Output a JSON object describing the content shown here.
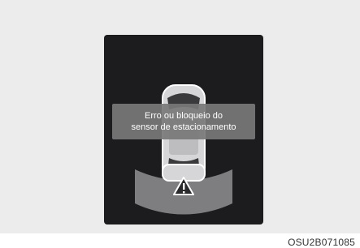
{
  "message": {
    "line1": "Erro ou bloqueio do",
    "line2": "sensor de estacionamento"
  },
  "figure_code": "OSU2B071085",
  "icons": {
    "warning": "warning-triangle-icon",
    "vehicle": "car-top-view-icon",
    "sensor_zone": "parking-sensor-arc"
  },
  "colors": {
    "page_background": "#ececec",
    "display_background": "#1c1c1e",
    "message_box": "#78787a",
    "sensor_arc": "#8a8a8c",
    "car_body": "#d6d6d8"
  }
}
